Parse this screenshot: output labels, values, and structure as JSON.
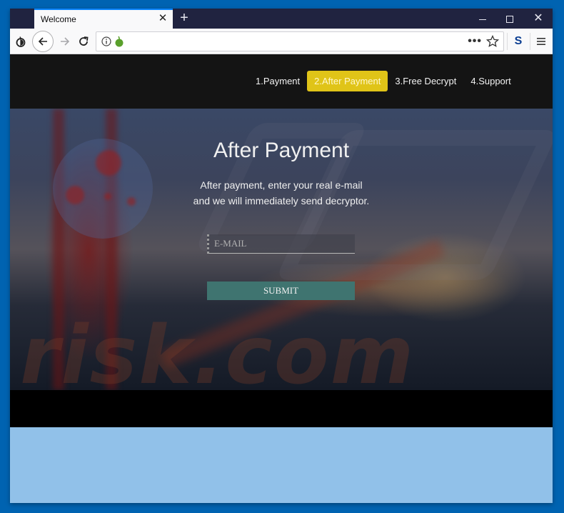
{
  "browser": {
    "tab_title": "Welcome",
    "tab_close": "✕",
    "new_tab": "+",
    "window_close": "✕",
    "overflow_menu": "•••",
    "extension_label": "S"
  },
  "nav": {
    "steps": [
      {
        "label": "1.Payment",
        "active": false
      },
      {
        "label": "2.After Payment",
        "active": true
      },
      {
        "label": "3.Free Decrypt",
        "active": false
      },
      {
        "label": "4.Support",
        "active": false
      }
    ]
  },
  "hero": {
    "title": "After Payment",
    "description_line1": "After payment, enter your real e-mail",
    "description_line2": "and we will immediately send decryptor.",
    "email_placeholder": "E-MAIL",
    "email_value": "",
    "submit_label": "SUBMIT",
    "watermark": "risk.com"
  },
  "colors": {
    "active_step": "#e0c418",
    "submit_button": "#3f7470",
    "desktop_bg": "#0063b1",
    "titlebar": "#202340"
  }
}
